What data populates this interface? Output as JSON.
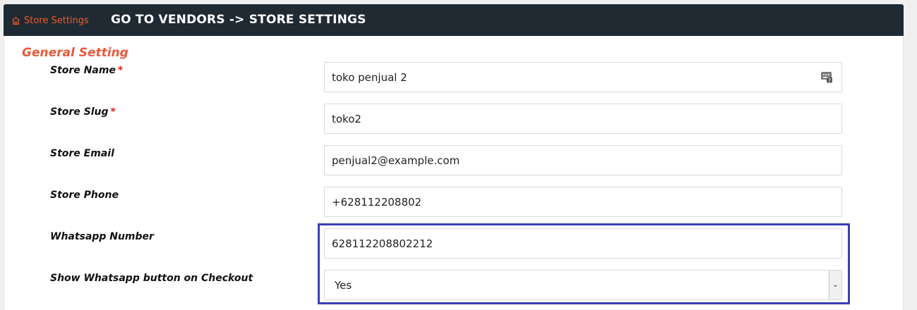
{
  "header": {
    "breadcrumb_label": "Store Settings",
    "page_title": "GO TO VENDORS -> STORE SETTINGS",
    "background": "#1f2a33",
    "accent": "#f05a28"
  },
  "form": {
    "section_title": "General Setting",
    "required_mark": "*",
    "fields": {
      "store_name": {
        "label": "Store Name",
        "value": "toko penjual 2"
      },
      "store_slug": {
        "label": "Store Slug",
        "value": "toko2"
      },
      "store_email": {
        "label": "Store Email",
        "value": "penjual2@example.com"
      },
      "store_phone": {
        "label": "Store Phone",
        "value": "+628112208802"
      },
      "whatsapp_number": {
        "label": "Whatsapp Number",
        "value": "628112208802212"
      },
      "show_whatsapp": {
        "label": "Show Whatsapp button on Checkout",
        "value": "Yes"
      }
    },
    "highlight_color": "#3b3fb3",
    "icons": {
      "breadcrumb": "home-icon",
      "store_name_field": "keyboard-icon",
      "select": "chevron-down-icon"
    }
  }
}
